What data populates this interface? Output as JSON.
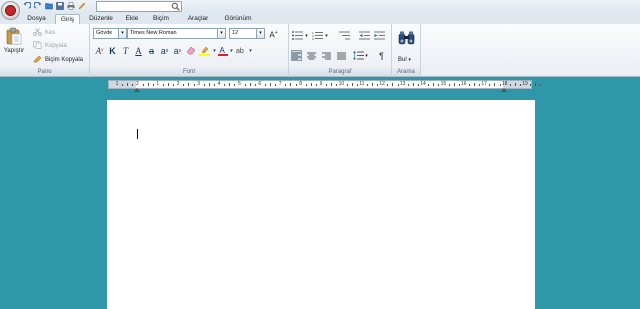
{
  "quick_access": {
    "search_placeholder": "",
    "icons": [
      "undo-icon",
      "redo-icon",
      "open-icon",
      "save-icon",
      "print-icon",
      "edit-icon"
    ]
  },
  "tabs": [
    {
      "label": "Dosya",
      "active": false
    },
    {
      "label": "Giriş",
      "active": true
    },
    {
      "label": "Düzenle",
      "active": false
    },
    {
      "label": "Ekle",
      "active": false
    },
    {
      "label": "Biçim",
      "active": false
    },
    {
      "label": "Araçlar",
      "active": false
    },
    {
      "label": "Görünüm",
      "active": false
    }
  ],
  "clipboard": {
    "group_label": "Pano",
    "paste_label": "Yapıştır",
    "cut_label": "Kes",
    "copy_label": "Kopyala",
    "format_painter_label": "Biçim Kopyala"
  },
  "font": {
    "group_label": "Font",
    "style_value": "Gövde",
    "family_value": "Times New Roman",
    "size_value": "12"
  },
  "paragraph": {
    "group_label": "Paragraf"
  },
  "search": {
    "group_label": "Arama",
    "find_label": "Bul"
  },
  "ruler": {
    "numbers": [
      "1",
      "2",
      "1",
      "2",
      "3",
      "4",
      "5",
      "6",
      "7",
      "8",
      "9",
      "10",
      "11",
      "12",
      "13",
      "14",
      "15",
      "16",
      "17",
      "18",
      "19"
    ]
  },
  "colors": {
    "workspace_bg": "#2e97a8",
    "highlight": "#ffff00",
    "font_color": "#e02020"
  }
}
